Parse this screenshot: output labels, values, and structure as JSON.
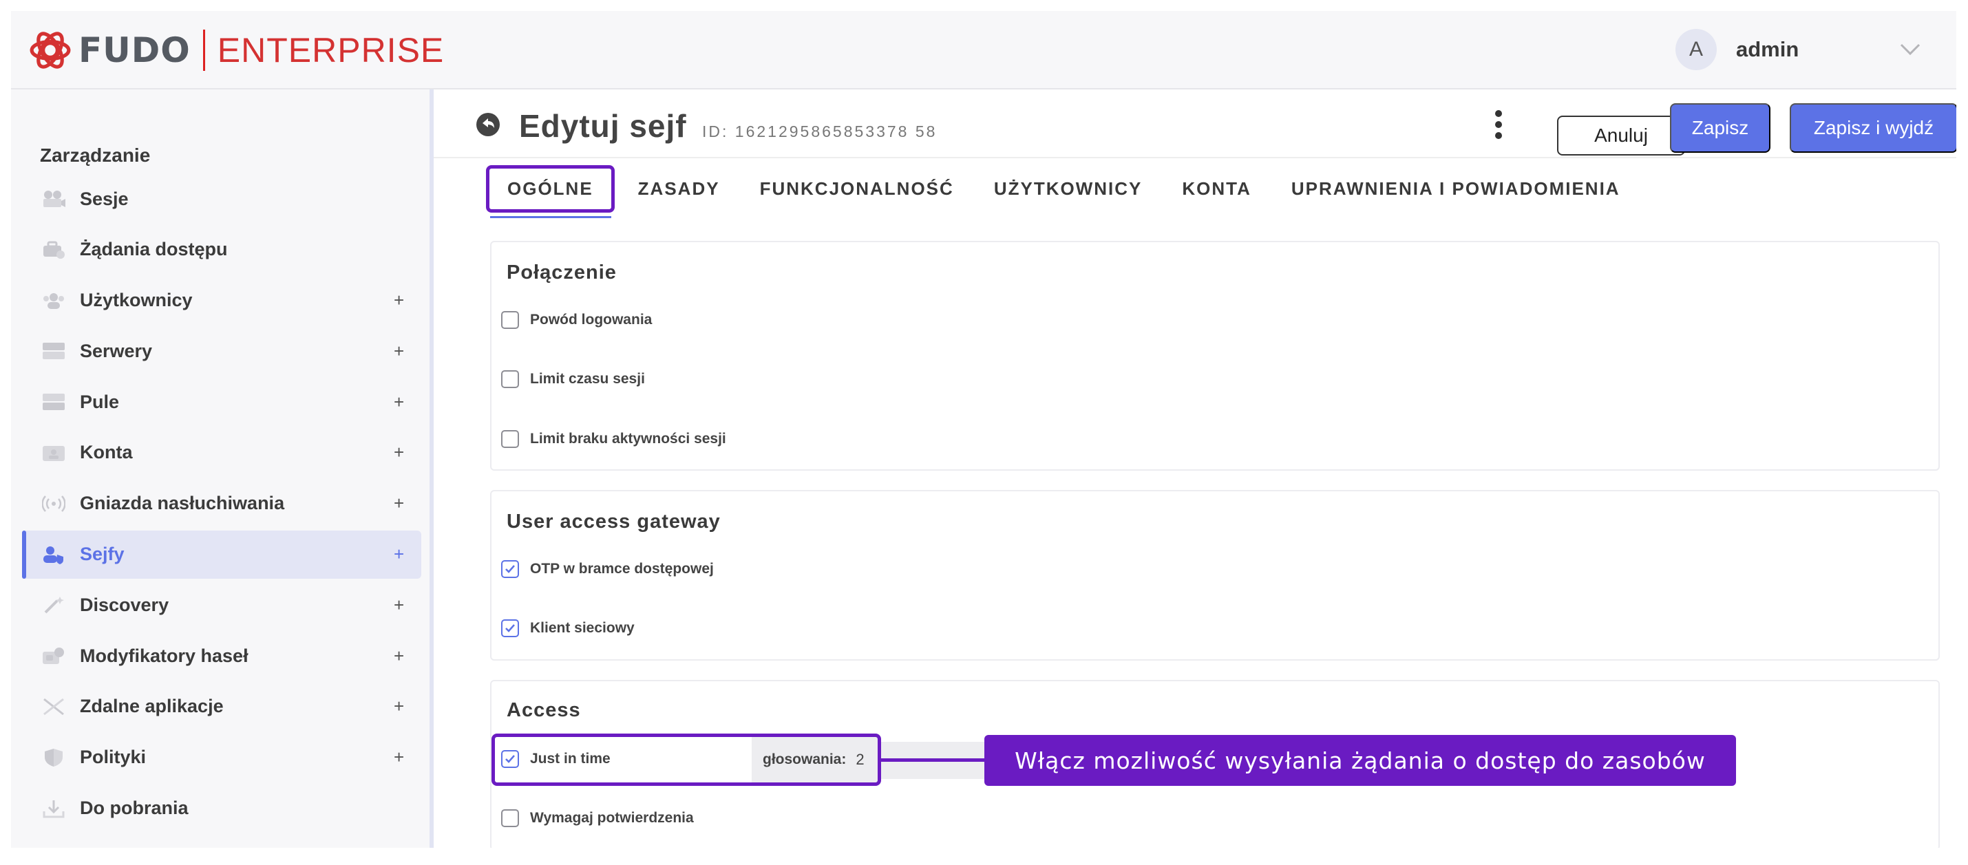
{
  "header": {
    "logo_text": "FUDO",
    "logo_sub": "ENTERPRISE",
    "user_initial": "A",
    "username": "admin"
  },
  "sidebar": {
    "title": "Zarządzanie",
    "items": [
      {
        "label": "Sesje",
        "plus": "",
        "icon": "camera-icon"
      },
      {
        "label": "Żądania dostępu",
        "plus": "",
        "icon": "access-request-icon"
      },
      {
        "label": "Użytkownicy",
        "plus": "+",
        "icon": "users-icon"
      },
      {
        "label": "Serwery",
        "plus": "+",
        "icon": "server-icon"
      },
      {
        "label": "Pule",
        "plus": "+",
        "icon": "pool-icon"
      },
      {
        "label": "Konta",
        "plus": "+",
        "icon": "account-icon"
      },
      {
        "label": "Gniazda nasłuchiwania",
        "plus": "+",
        "icon": "listener-icon"
      },
      {
        "label": "Sejfy",
        "plus": "+",
        "icon": "safe-icon",
        "active": true
      },
      {
        "label": "Discovery",
        "plus": "+",
        "icon": "wand-icon"
      },
      {
        "label": "Modyfikatory haseł",
        "plus": "+",
        "icon": "password-modifier-icon"
      },
      {
        "label": "Zdalne aplikacje",
        "plus": "+",
        "icon": "remote-app-icon"
      },
      {
        "label": "Polityki",
        "plus": "+",
        "icon": "shield-icon"
      },
      {
        "label": "Do pobrania",
        "plus": "",
        "icon": "download-icon"
      }
    ]
  },
  "page": {
    "title": "Edytuj sejf",
    "id_text": "ID: 1621295865853378 58",
    "cancel_label": "Anuluj",
    "save_label": "Zapisz",
    "save_exit_label": "Zapisz i wyjdź"
  },
  "tabs": [
    "OGÓLNE",
    "ZASADY",
    "FUNKCJONALNOŚĆ",
    "UŻYTKOWNICY",
    "KONTA",
    "UPRAWNIENIA I POWIADOMIENIA"
  ],
  "sections": {
    "connection": {
      "title": "Połączenie",
      "options": [
        {
          "label": "Powód logowania",
          "checked": false
        },
        {
          "label": "Limit czasu sesji",
          "checked": false
        },
        {
          "label": "Limit braku aktywności sesji",
          "checked": false
        }
      ]
    },
    "gateway": {
      "title": "User access gateway",
      "options": [
        {
          "label": "OTP w bramce dostępowej",
          "checked": true
        },
        {
          "label": "Klient sieciowy",
          "checked": true
        }
      ]
    },
    "access": {
      "title": "Access",
      "options": [
        {
          "label": "Just in time",
          "checked": true
        },
        {
          "label": "Wymagaj potwierdzenia",
          "checked": false
        }
      ],
      "votes_label": "głosowania:",
      "votes_value": "2"
    }
  },
  "callout": "Włącz mozliwość wysyłania żądania o dostęp do zasobów",
  "colors": {
    "accent": "#5c72e6",
    "highlight": "#6a1bc2",
    "logo_red": "#d43232"
  }
}
